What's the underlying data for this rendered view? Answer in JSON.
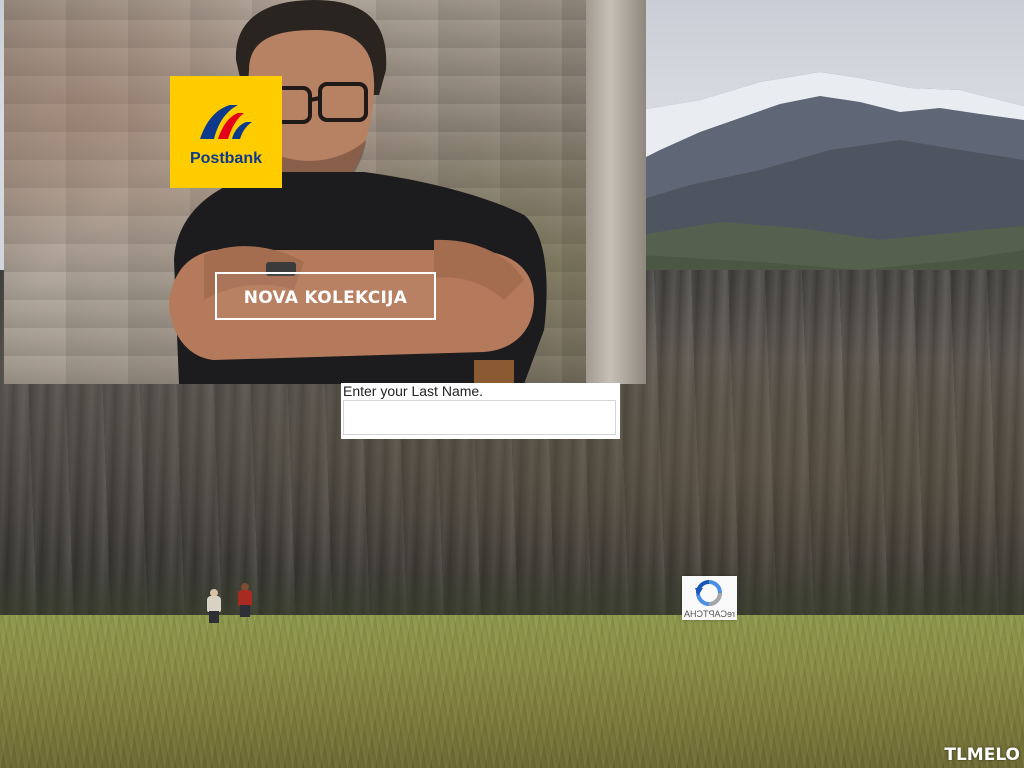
{
  "banner": {
    "logo_text": "Postbank",
    "button_label": "NOVA KOLEKCIJA"
  },
  "form": {
    "last_name_label": "Enter your Last Name.",
    "last_name_value": "",
    "last_name_placeholder": ""
  },
  "recaptcha": {
    "label": "reCAPTCHA",
    "icon": "recaptcha-icon"
  },
  "watermark": {
    "text": "TLMELO"
  },
  "colors": {
    "postbank_yellow": "#ffcc00",
    "postbank_blue": "#0e3a8c",
    "postbank_red": "#e2001a"
  }
}
